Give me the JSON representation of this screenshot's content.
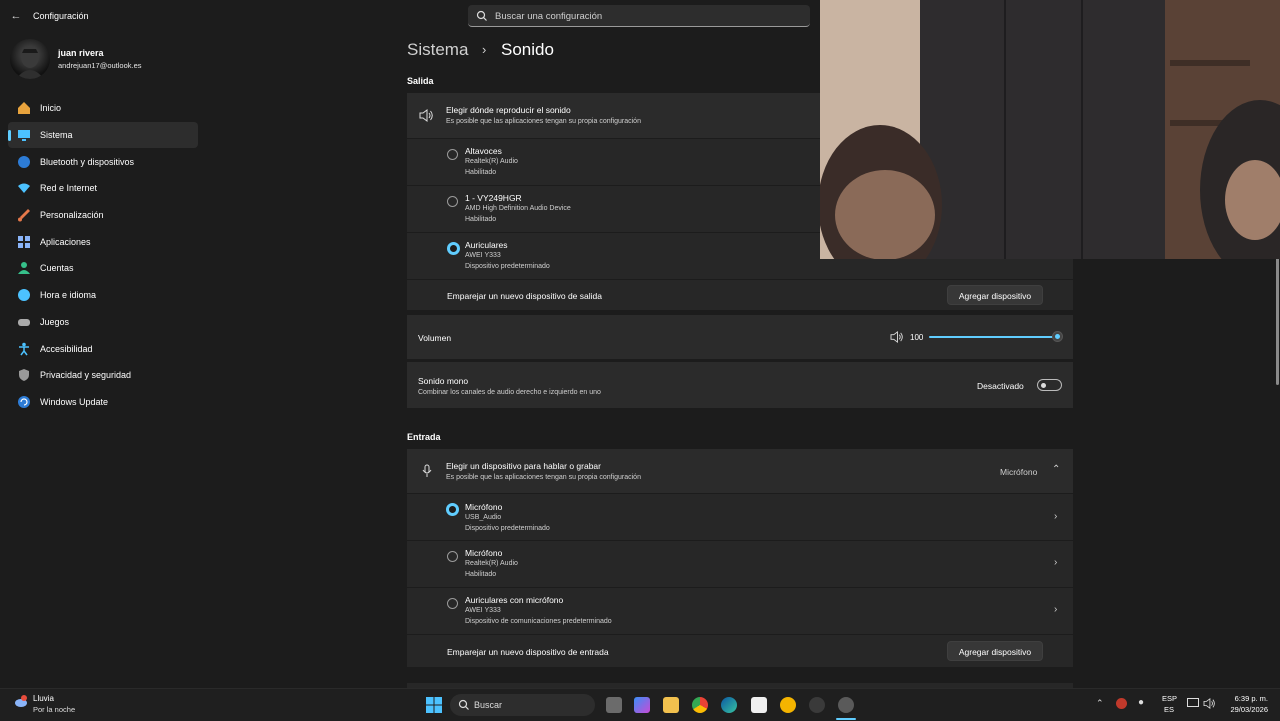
{
  "app": {
    "title": "Configuración"
  },
  "search": {
    "placeholder": "Buscar una configuración"
  },
  "user": {
    "name": "juan rivera",
    "email": "andrejuan17@outlook.es"
  },
  "nav": [
    {
      "label": "Inicio",
      "icon": "home-icon",
      "color": "#e8a33d"
    },
    {
      "label": "Sistema",
      "icon": "monitor-icon",
      "color": "#4cc2ff",
      "active": true
    },
    {
      "label": "Bluetooth y dispositivos",
      "icon": "bluetooth-icon",
      "color": "#2d7cd6"
    },
    {
      "label": "Red e Internet",
      "icon": "wifi-icon",
      "color": "#4cc2ff"
    },
    {
      "label": "Personalización",
      "icon": "brush-icon",
      "color": "#e6784a"
    },
    {
      "label": "Aplicaciones",
      "icon": "apps-icon",
      "color": "#8ab4f8"
    },
    {
      "label": "Cuentas",
      "icon": "person-icon",
      "color": "#36c08a"
    },
    {
      "label": "Hora e idioma",
      "icon": "globe-clock-icon",
      "color": "#4cc2ff"
    },
    {
      "label": "Juegos",
      "icon": "gamepad-icon",
      "color": "#aaaaaa"
    },
    {
      "label": "Accesibilidad",
      "icon": "accessibility-icon",
      "color": "#4cc2ff"
    },
    {
      "label": "Privacidad y seguridad",
      "icon": "shield-icon",
      "color": "#9a9a9a"
    },
    {
      "label": "Windows Update",
      "icon": "update-icon",
      "color": "#2d7cd6"
    }
  ],
  "breadcrumb": {
    "parent": "Sistema",
    "current": "Sonido"
  },
  "output": {
    "heading": "Salida",
    "chooser": {
      "title": "Elegir dónde reproducir el sonido",
      "subtitle": "Es posible que las aplicaciones tengan su propia configuración"
    },
    "devices": [
      {
        "name": "Altavoces",
        "driver": "Realtek(R) Audio",
        "status": "Habilitado",
        "selected": false
      },
      {
        "name": "1 - VY249HGR",
        "driver": "AMD High Definition Audio Device",
        "status": "Habilitado",
        "selected": false
      },
      {
        "name": "Auriculares",
        "driver": "AWEI Y333",
        "status": "Dispositivo predeterminado",
        "selected": true
      }
    ],
    "pair": {
      "label": "Emparejar un nuevo dispositivo de salida",
      "button": "Agregar dispositivo"
    },
    "volume": {
      "label": "Volumen",
      "value": "100",
      "level": 1.0
    },
    "mono": {
      "title": "Sonido mono",
      "subtitle": "Combinar los canales de audio derecho e izquierdo en uno",
      "state": "Desactivado"
    }
  },
  "input": {
    "heading": "Entrada",
    "chooser": {
      "title": "Elegir un dispositivo para hablar o grabar",
      "subtitle": "Es posible que las aplicaciones tengan su propia configuración",
      "selected": "Micrófono"
    },
    "devices": [
      {
        "name": "Micrófono",
        "driver": "USB_Audio",
        "status": "Dispositivo predeterminado",
        "selected": true
      },
      {
        "name": "Micrófono",
        "driver": "Realtek(R) Audio",
        "status": "Habilitado",
        "selected": false
      },
      {
        "name": "Auriculares con micrófono",
        "driver": "AWEI Y333",
        "status": "Dispositivo de comunicaciones predeterminado",
        "selected": false
      }
    ],
    "pair": {
      "label": "Emparejar un nuevo dispositivo de entrada",
      "button": "Agregar dispositivo"
    }
  },
  "taskbar": {
    "weather": {
      "title": "Lluvia",
      "subtitle": "Por la noche"
    },
    "search_label": "Buscar",
    "lang": {
      "line1": "ESP",
      "line2": "ES"
    },
    "time": "6:39 p. m.",
    "date": "29/03/2026"
  },
  "colors": {
    "accent": "#60cdff",
    "background": "#1c1c1c",
    "card": "#2b2b2b"
  }
}
